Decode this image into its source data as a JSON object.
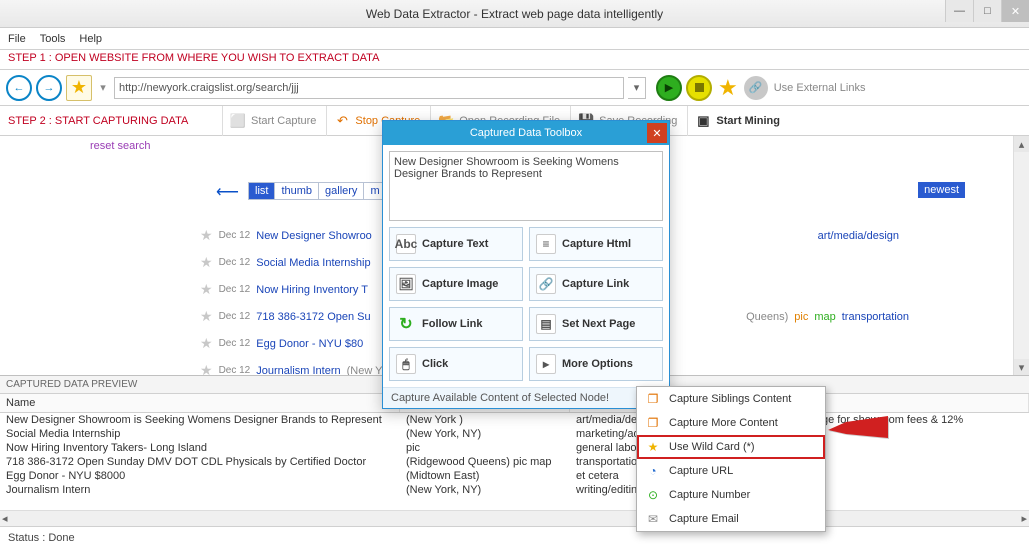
{
  "window": {
    "title": "Web Data Extractor -  Extract web page data intelligently"
  },
  "menubar": {
    "file": "File",
    "tools": "Tools",
    "help": "Help"
  },
  "step1": "STEP 1 : OPEN WEBSITE FROM WHERE YOU WISH TO EXTRACT DATA",
  "nav": {
    "url": "http://newyork.craigslist.org/search/jjj",
    "external": "Use External Links"
  },
  "step2": "STEP 2 : START CAPTURING DATA",
  "toolbar": {
    "start_capture": "Start Capture",
    "stop_capture": "Stop Capture",
    "open_recording": "Open Recording File",
    "save_recording": "Save Recording",
    "start_mining": "Start Mining"
  },
  "page": {
    "reset": "reset search",
    "tabs": {
      "list": "list",
      "thumb": "thumb",
      "gallery": "gallery",
      "more": "m"
    },
    "newest": "newest",
    "rows": [
      {
        "date": "Dec 12",
        "title": "New Designer Showroo",
        "extra": "",
        "tags": {
          "cat": "art/media/design"
        }
      },
      {
        "date": "Dec 12",
        "title": "Social Media Internship",
        "extra": ""
      },
      {
        "date": "Dec 12",
        "title": "Now Hiring Inventory T",
        "extra": ""
      },
      {
        "date": "Dec 12",
        "title": "718 386-3172 Open Su",
        "extra": "Queens)",
        "tags": {
          "pic": "pic",
          "map": "map",
          "cat": "transportation"
        }
      },
      {
        "date": "Dec 12",
        "title": "Egg Donor - NYU $80",
        "extra": ""
      },
      {
        "date": "Dec 12",
        "title": "Journalism Intern",
        "extra": "(New Y"
      }
    ]
  },
  "dialog": {
    "title": "Captured Data Toolbox",
    "preview_text": "New Designer Showroom is Seeking Womens Designer Brands to Represent",
    "buttons": {
      "capture_text": "Capture Text",
      "capture_html": "Capture Html",
      "capture_image": "Capture Image",
      "capture_link": "Capture Link",
      "follow_link": "Follow Link",
      "set_next_page": "Set Next Page",
      "click": "Click",
      "more_options": "More Options"
    },
    "status": "Capture Available Content of Selected Node!"
  },
  "context_menu": {
    "siblings": "Capture Siblings Content",
    "more": "Capture More Content",
    "wildcard": "Use Wild Card (*)",
    "url": "Capture URL",
    "number": "Capture Number",
    "email": "Capture Email"
  },
  "preview": {
    "header": "CAPTURED DATA PREVIEW",
    "col_name": "Name",
    "rows": [
      {
        "c1": "New Designer Showroom is Seeking Womens Designer Brands to Represent",
        "c2": "(New York )",
        "c3": "art/media/design",
        "c4": "r your company in exchange for showroom fees & 12%"
      },
      {
        "c1": "Social Media Internship",
        "c2": "(New York, NY)",
        "c3": "marketing/advertising",
        "c4": ""
      },
      {
        "c1": "Now Hiring Inventory Takers- Long Island",
        "c2": "pic",
        "c3": "general labor",
        "c4": ""
      },
      {
        "c1": "718 386-3172 Open Sunday DMV DOT CDL Physicals by Certified Doctor",
        "c2": "(Ridgewood Queens) pic map",
        "c3": "transportation",
        "c4": ""
      },
      {
        "c1": "Egg Donor - NYU $8000",
        "c2": "(Midtown East)",
        "c3": "et cetera",
        "c4": ""
      },
      {
        "c1": "Journalism Intern",
        "c2": "(New York, NY)",
        "c3": "writing/editing",
        "c4": "--"
      }
    ]
  },
  "status": "Status :  Done"
}
